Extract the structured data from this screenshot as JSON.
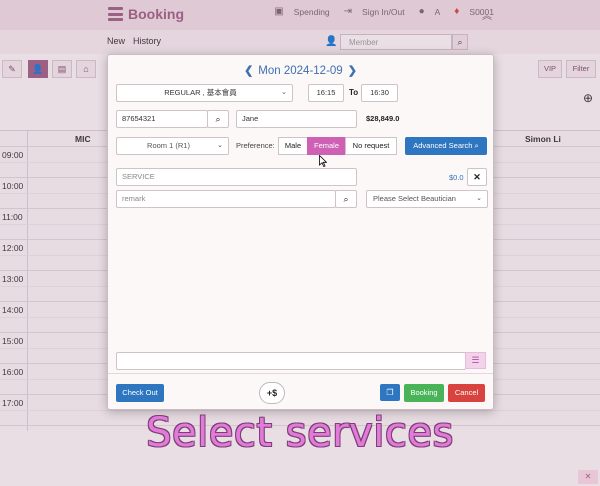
{
  "app": {
    "brand": "Booking",
    "top_links": [
      {
        "icon": "money-icon",
        "label": "Spending"
      },
      {
        "icon": "sign-in-icon",
        "label": "Sign In/Out"
      },
      {
        "icon": "user-icon",
        "label": "A"
      },
      {
        "icon": "location-icon",
        "label": "S0001"
      }
    ],
    "nav": {
      "new_label": "New",
      "history_label": "History"
    },
    "member_search": {
      "placeholder": "Member"
    },
    "toolbar": {
      "vip_label": "VIP",
      "filter_label": "Filter"
    },
    "calendar": {
      "columns": [
        "MIC",
        "Simon Li"
      ],
      "times": [
        "09:00",
        "10:00",
        "11:00",
        "12:00",
        "13:00",
        "14:00",
        "15:00",
        "16:00",
        "17:00"
      ]
    }
  },
  "modal": {
    "date_label": "Mon 2024-12-09",
    "prev_icon": "chevron-left-icon",
    "next_icon": "chevron-right-icon",
    "booking_type": "REGULAR , 基本會員",
    "start_time": "16:15",
    "to_label": "To",
    "end_time": "16:30",
    "phone": "87654321",
    "name": "Jane",
    "balance": "$28,849.0",
    "room": "Room 1 (R1)",
    "preference_label": "Preference:",
    "preference_options": [
      "Male",
      "Female",
      "No request"
    ],
    "preference_selected": "Female",
    "advanced_search_label": "Advanced Search",
    "service_placeholder": "SERVICE",
    "service_price": "$0.0",
    "remark_placeholder": "remark",
    "beautician_placeholder": "Please Select Beautician",
    "footer": {
      "checkout_label": "Check Out",
      "add_price_label": "+$",
      "booking_label": "Booking",
      "cancel_label": "Cancel"
    }
  },
  "caption": "Select services",
  "colors": {
    "brand": "#9c5f84",
    "accent_pink": "#cf61b5",
    "primary_blue": "#2f76c0",
    "success_green": "#48b357",
    "danger_red": "#d9433f"
  }
}
